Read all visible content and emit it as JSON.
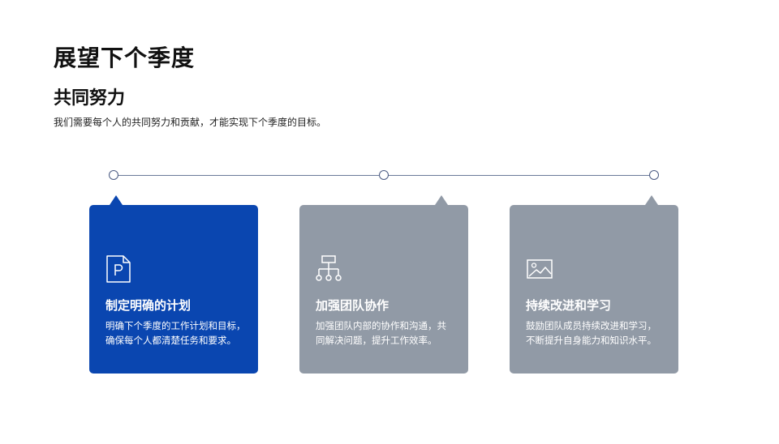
{
  "header": {
    "title": "展望下个季度",
    "subtitle": "共同努力",
    "description": "我们需要每个人的共同努力和贡献，才能实现下个季度的目标。"
  },
  "colors": {
    "accent": "#0a46b0",
    "muted_card": "#919aa6",
    "timeline": "#6b7a99"
  },
  "cards": [
    {
      "icon": "document-p-icon",
      "title": "制定明确的计划",
      "line1": "明确下个季度的工作计划和目标，",
      "line2": "确保每个人都清楚任务和要求。"
    },
    {
      "icon": "org-chart-icon",
      "title": "加强团队协作",
      "line1": "加强团队内部的协作和沟通，共",
      "line2": "同解决问题，提升工作效率。"
    },
    {
      "icon": "image-icon",
      "title": "持续改进和学习",
      "line1": "鼓励团队成员持续改进和学习，",
      "line2": "不断提升自身能力和知识水平。"
    }
  ]
}
